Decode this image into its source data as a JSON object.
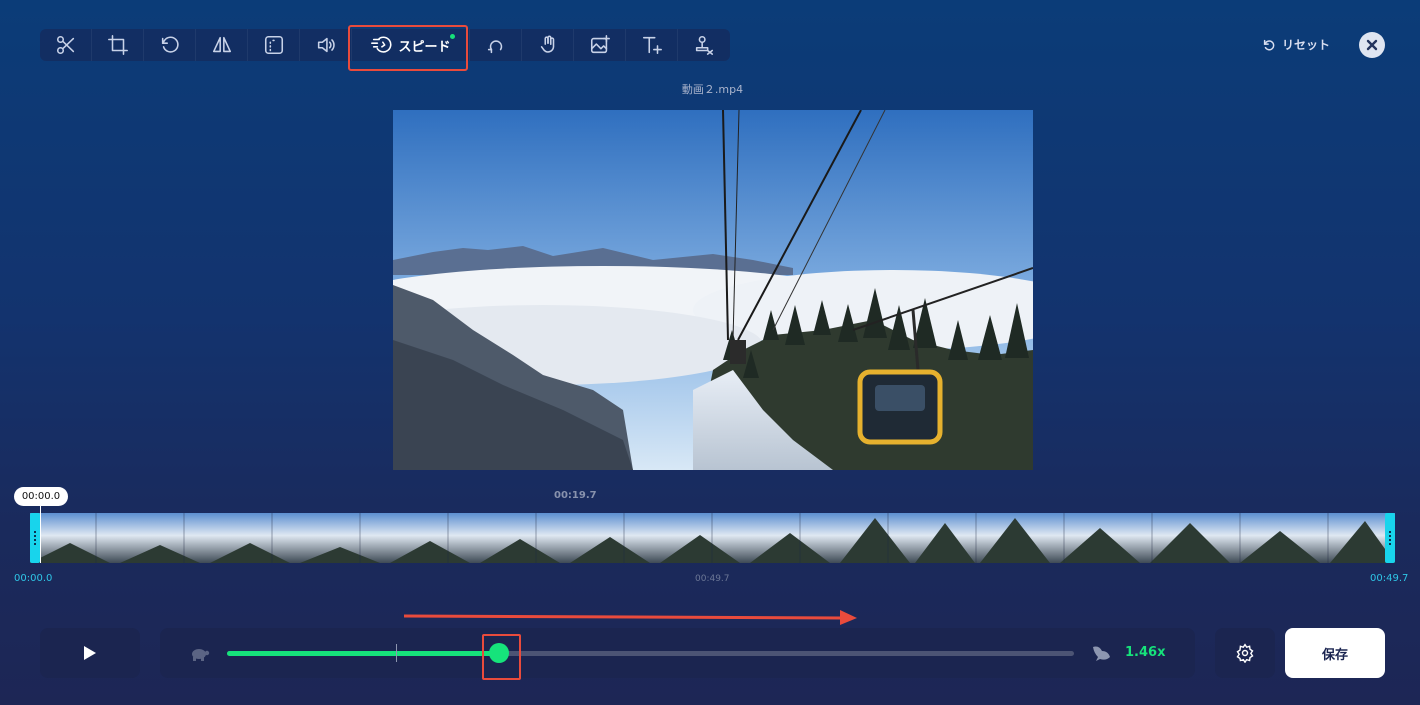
{
  "toolbar": {
    "tools": [
      {
        "name": "scissors-icon"
      },
      {
        "name": "crop-icon"
      },
      {
        "name": "rotate-icon"
      },
      {
        "name": "flip-icon"
      },
      {
        "name": "frame-icon"
      },
      {
        "name": "volume-icon"
      },
      {
        "name": "speed-icon",
        "label": "スピード",
        "active": true
      },
      {
        "name": "loop-icon"
      },
      {
        "name": "stabilize-icon"
      },
      {
        "name": "add-image-icon"
      },
      {
        "name": "add-text-icon"
      },
      {
        "name": "remove-watermark-icon"
      }
    ],
    "speed_label": "スピード"
  },
  "header": {
    "reset_label": "リセット",
    "filename": "動画２.mp4"
  },
  "timeline": {
    "playhead_time": "00:00.0",
    "top_mid_time": "00:19.7",
    "start_time": "00:00.0",
    "mid_time": "00:49.7",
    "end_time": "00:49.7"
  },
  "speed": {
    "value_label": "1.46x",
    "slider_fraction": 0.321
  },
  "actions": {
    "save_label": "保存"
  },
  "colors": {
    "accent_green": "#16e37b",
    "highlight_red": "#e94b3c",
    "timeline_cyan": "#18d4ec"
  }
}
